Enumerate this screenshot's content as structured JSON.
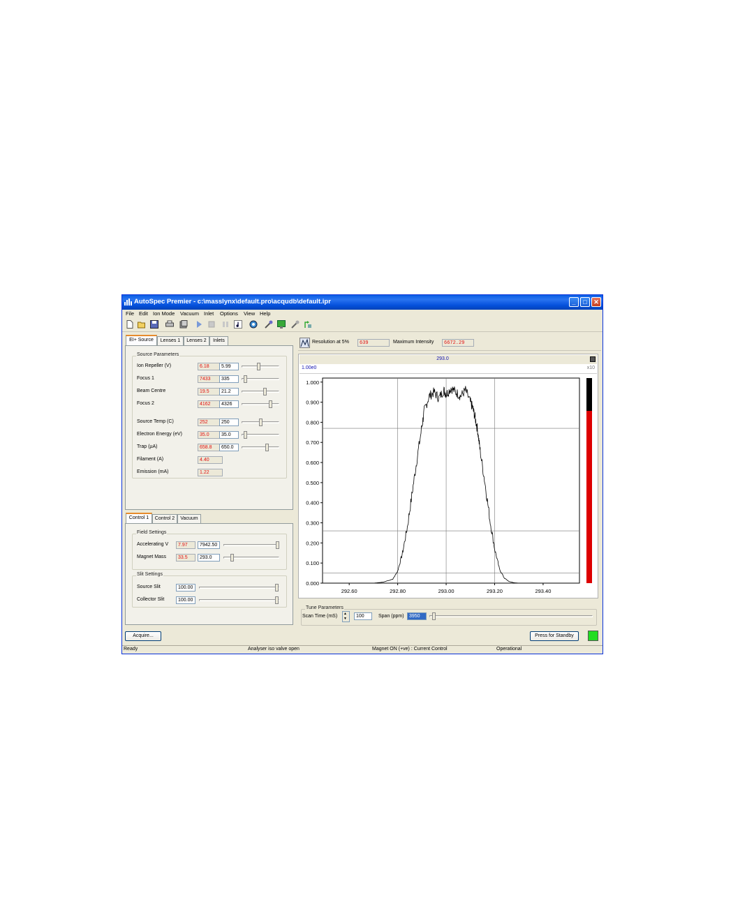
{
  "window": {
    "title": "AutoSpec Premier - c:\\masslynx\\default.pro\\acqudb\\default.ipr",
    "minimize_label": "_",
    "maximize_label": "□",
    "close_label": "✕"
  },
  "menu": [
    "File",
    "Edit",
    "Ion Mode",
    "Vacuum",
    "Inlet",
    "Options",
    "View",
    "Help"
  ],
  "toolbar_icons": [
    "new-icon",
    "open-icon",
    "save-icon",
    "print-icon",
    "copy-icon",
    "play-icon",
    "stop-icon",
    "pause-icon",
    "tune-icon",
    "refresh-icon",
    "reference-icon",
    "display-icon",
    "calibrate-icon",
    "export-icon"
  ],
  "source_tabs": [
    "EI+ Source",
    "Lenses 1",
    "Lenses 2",
    "Inlets"
  ],
  "source_params": {
    "group_label": "Source Parameters",
    "rows": [
      {
        "label": "Ion Repeller (V)",
        "readback": "6.18",
        "setpoint": "5.99",
        "slider": 0.45
      },
      {
        "label": "Focus 1",
        "readback": "7433",
        "setpoint": "335",
        "slider": 0.1
      },
      {
        "label": "Beam Centre",
        "readback": "19.5",
        "setpoint": "21.2",
        "slider": 0.62
      },
      {
        "label": "Focus 2",
        "readback": "4162",
        "setpoint": "4326",
        "slider": 0.78
      },
      {
        "label": "Source Temp (C)",
        "readback": "252",
        "setpoint": "250",
        "slider": 0.5
      },
      {
        "label": "Electron Energy (eV)",
        "readback": "35.0",
        "setpoint": "35.0",
        "slider": 0.1
      },
      {
        "label": "Trap (µA)",
        "readback": "658.8",
        "setpoint": "650.0",
        "slider": 0.68
      },
      {
        "label": "Filament (A)",
        "readback": "4.40"
      },
      {
        "label": "Emission (mA)",
        "readback": "1.22"
      }
    ]
  },
  "control_tabs": [
    "Control 1",
    "Control 2",
    "Vacuum"
  ],
  "field_settings": {
    "group_label": "Field Settings",
    "rows": [
      {
        "label": "Accelerating V",
        "readback": "7.97",
        "setpoint": "7942.50",
        "slider": 0.97
      },
      {
        "label": "Magnet Mass",
        "readback": "33.5",
        "setpoint": "293.0",
        "slider": 0.15
      }
    ]
  },
  "slit_settings": {
    "group_label": "Slit Settings",
    "rows": [
      {
        "label": "Source Slit",
        "setpoint": "100.00",
        "slider": 0.97
      },
      {
        "label": "Collector Slit",
        "setpoint": "100.00",
        "slider": 0.97
      }
    ]
  },
  "resolution": {
    "label": "Resolution at 5%",
    "value": "639",
    "max_label": "Maximum Intensity",
    "max_value": "6672.29"
  },
  "peak": {
    "mass_header": "293.0",
    "scale_label": "1.00e0",
    "multiplier": "x10"
  },
  "chart_data": {
    "type": "line",
    "title": "",
    "xlabel": "",
    "ylabel": "",
    "x_ticks": [
      "292.60",
      "292.80",
      "293.00",
      "293.20",
      "293.40"
    ],
    "y_ticks": [
      "0.000",
      "0.100",
      "0.200",
      "0.300",
      "0.400",
      "0.500",
      "0.600",
      "0.700",
      "0.800",
      "0.900",
      "1.000"
    ],
    "xlim": [
      292.49,
      293.55
    ],
    "ylim": [
      0,
      1.02
    ],
    "grid": true,
    "series": [
      {
        "x": [
          292.6,
          292.7,
          292.74,
          292.78,
          292.8,
          292.82,
          292.84,
          292.86,
          292.88,
          292.9,
          292.91,
          292.93,
          292.95,
          292.97,
          292.99,
          293.0,
          293.02,
          293.04,
          293.06,
          293.08,
          293.1,
          293.11,
          293.12,
          293.13,
          293.14,
          293.16,
          293.18,
          293.2,
          293.22,
          293.24,
          293.26,
          293.28,
          293.3,
          293.35,
          293.45
        ],
        "y": [
          0.0,
          0.0,
          0.005,
          0.02,
          0.06,
          0.15,
          0.28,
          0.45,
          0.62,
          0.78,
          0.86,
          0.93,
          0.95,
          0.92,
          0.96,
          0.94,
          0.97,
          0.95,
          0.93,
          0.96,
          0.9,
          0.87,
          0.82,
          0.76,
          0.66,
          0.5,
          0.32,
          0.17,
          0.07,
          0.025,
          0.008,
          0.002,
          0.0,
          0.0,
          0.0
        ]
      }
    ],
    "horizontal_lines": [
      0.05,
      0.26,
      0.77
    ],
    "intensity_bar": {
      "level": 0.84,
      "color": "#dd0000",
      "top_color": "#000000"
    }
  },
  "tune": {
    "group_label": "Tune Parameters",
    "scan_time_label": "Scan Time (mS)",
    "scan_time": "100",
    "span_label": "Span (ppm)",
    "span": "3950"
  },
  "buttons": {
    "acquire": "Acquire...",
    "standby": "Press for Standby"
  },
  "status_light_color": "#22dd22",
  "statusbar": [
    "Ready",
    "Analyser iso valve open",
    "Magnet ON (+ve) : Current Control",
    "Operational"
  ]
}
